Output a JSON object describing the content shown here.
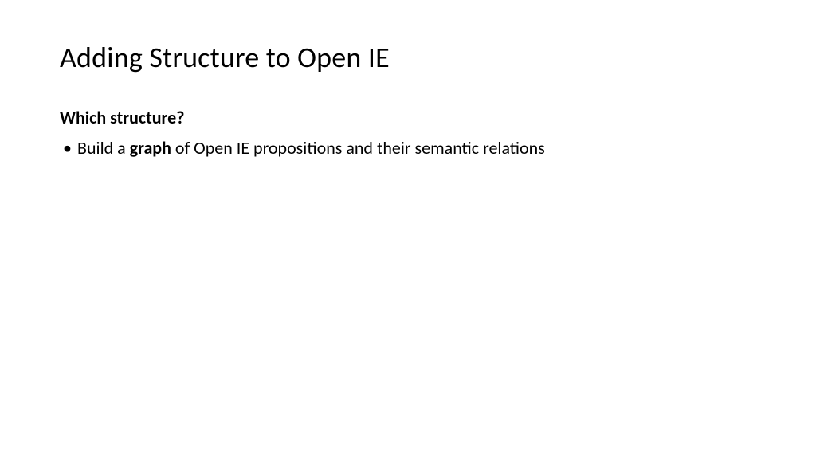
{
  "slide": {
    "title": "Adding Structure to Open IE",
    "subheading": "Which structure?",
    "bullets": [
      {
        "pre": "Build a ",
        "bold": "graph",
        "post": " of Open IE propositions and their semantic relations"
      }
    ]
  }
}
